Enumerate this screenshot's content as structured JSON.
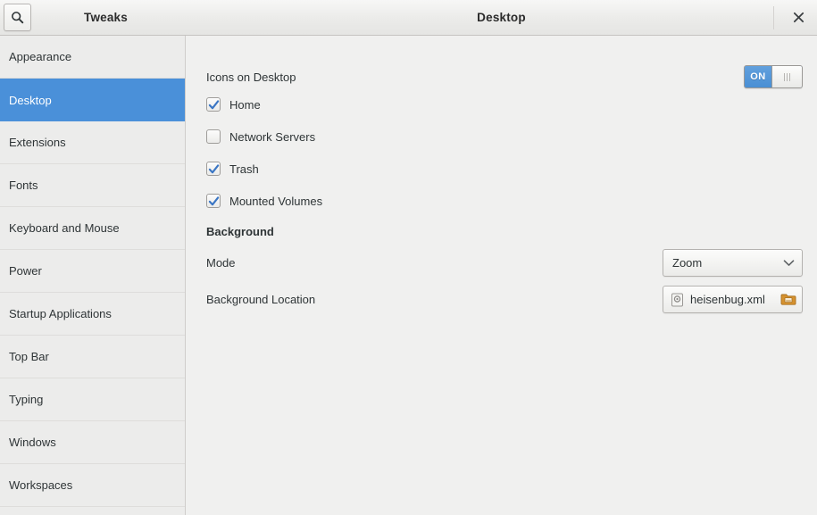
{
  "window": {
    "app_title": "Tweaks",
    "page_title": "Desktop",
    "search_icon": "search-icon",
    "close_icon": "close-icon"
  },
  "sidebar": {
    "items": [
      {
        "label": "Appearance",
        "selected": false
      },
      {
        "label": "Desktop",
        "selected": true
      },
      {
        "label": "Extensions",
        "selected": false
      },
      {
        "label": "Fonts",
        "selected": false
      },
      {
        "label": "Keyboard and Mouse",
        "selected": false
      },
      {
        "label": "Power",
        "selected": false
      },
      {
        "label": "Startup Applications",
        "selected": false
      },
      {
        "label": "Top Bar",
        "selected": false
      },
      {
        "label": "Typing",
        "selected": false
      },
      {
        "label": "Windows",
        "selected": false
      },
      {
        "label": "Workspaces",
        "selected": false
      }
    ]
  },
  "content": {
    "icons_on_desktop": {
      "label": "Icons on Desktop",
      "switch_state": "ON",
      "switch_on": true
    },
    "checkboxes": [
      {
        "label": "Home",
        "checked": true
      },
      {
        "label": "Network Servers",
        "checked": false
      },
      {
        "label": "Trash",
        "checked": true
      },
      {
        "label": "Mounted Volumes",
        "checked": true
      }
    ],
    "background_section": {
      "heading": "Background",
      "mode": {
        "label": "Mode",
        "value": "Zoom",
        "dropdown_icon": "chevron-down-icon"
      },
      "location": {
        "label": "Background Location",
        "value": "heisenbug.xml",
        "file_icon": "document-icon",
        "browse_icon": "folder-icon"
      }
    }
  },
  "colors": {
    "accent": "#4a90d9",
    "window_bg": "#f0f0ef",
    "sidebar_bg": "#ececeb",
    "folder_icon": "#d6922f"
  }
}
